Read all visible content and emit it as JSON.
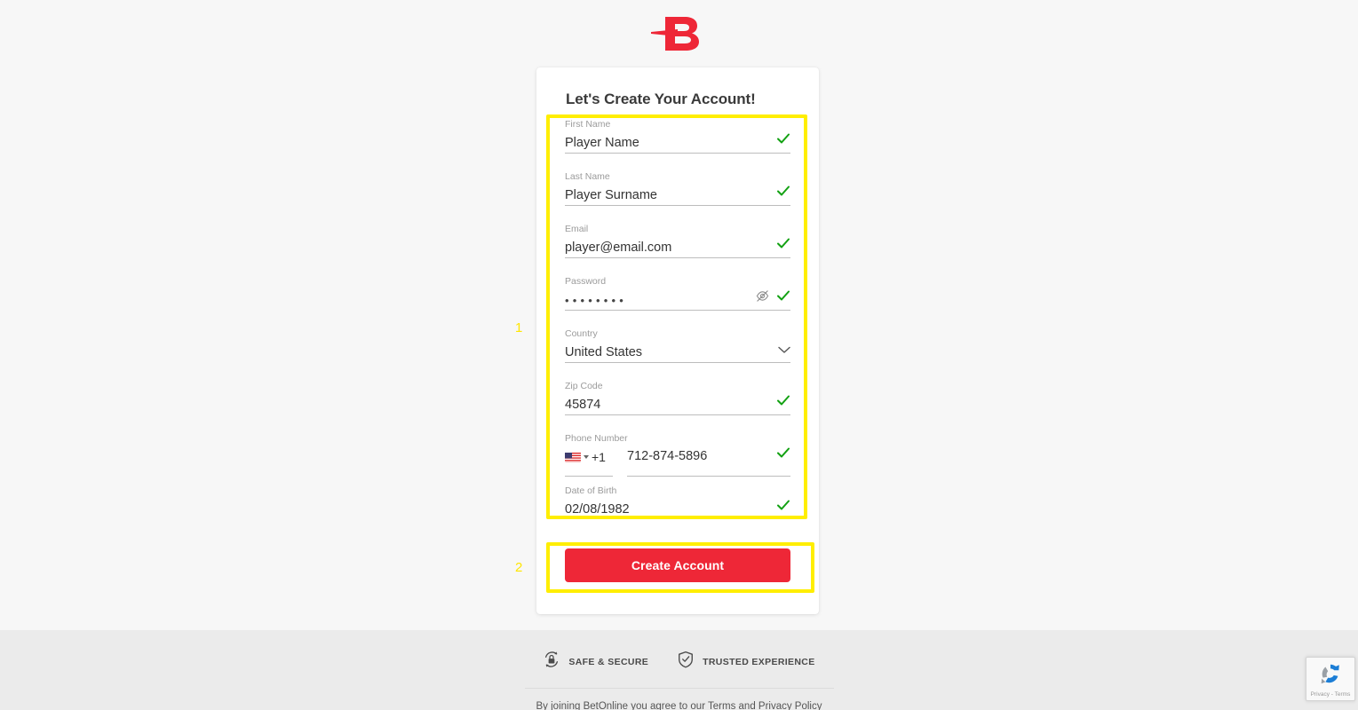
{
  "brand": {
    "logo_letter": "B",
    "logo_color": "#ee2737",
    "name": "BetOnline"
  },
  "card": {
    "title": "Let's Create Your Account!"
  },
  "form": {
    "fields": [
      {
        "label": "First Name",
        "value": "Player Name",
        "valid": true,
        "type": "text"
      },
      {
        "label": "Last Name",
        "value": "Player Surname",
        "valid": true,
        "type": "text"
      },
      {
        "label": "Email",
        "value": "player@email.com",
        "valid": true,
        "type": "email"
      },
      {
        "label": "Password",
        "value": "••••••••",
        "valid": true,
        "type": "password"
      },
      {
        "label": "Country",
        "value": "United States",
        "valid": false,
        "type": "select"
      },
      {
        "label": "Zip Code",
        "value": "45874",
        "valid": true,
        "type": "text"
      },
      {
        "label": "Phone Number",
        "value": "712-874-5896",
        "valid": true,
        "type": "phone"
      },
      {
        "label": "Date of Birth",
        "value": "02/08/1982",
        "valid": true,
        "type": "date"
      }
    ],
    "phone": {
      "country_code": "+1",
      "flag": "us-flag-icon"
    },
    "submit_label": "Create Account"
  },
  "annotations": [
    {
      "number": "1",
      "color": "#ffe600",
      "target": "form-fields-group"
    },
    {
      "number": "2",
      "color": "#ffe600",
      "target": "create-account-button"
    }
  ],
  "footer": {
    "badges": [
      {
        "icon": "lock-refresh-icon",
        "text": "SAFE & SECURE"
      },
      {
        "icon": "shield-check-icon",
        "text": "TRUSTED EXPERIENCE"
      }
    ],
    "legal_prefix": "By joining BetOnline you agree to our ",
    "legal_terms": "Terms",
    "legal_and": " and ",
    "legal_privacy": "Privacy Policy"
  },
  "recaptcha": {
    "label": "Privacy - Terms"
  },
  "colors": {
    "accent": "#ee2737",
    "success": "#12a112",
    "annotation": "#ffee00",
    "page_bg": "#f7f7f7",
    "footer_bg": "#ebebeb"
  }
}
